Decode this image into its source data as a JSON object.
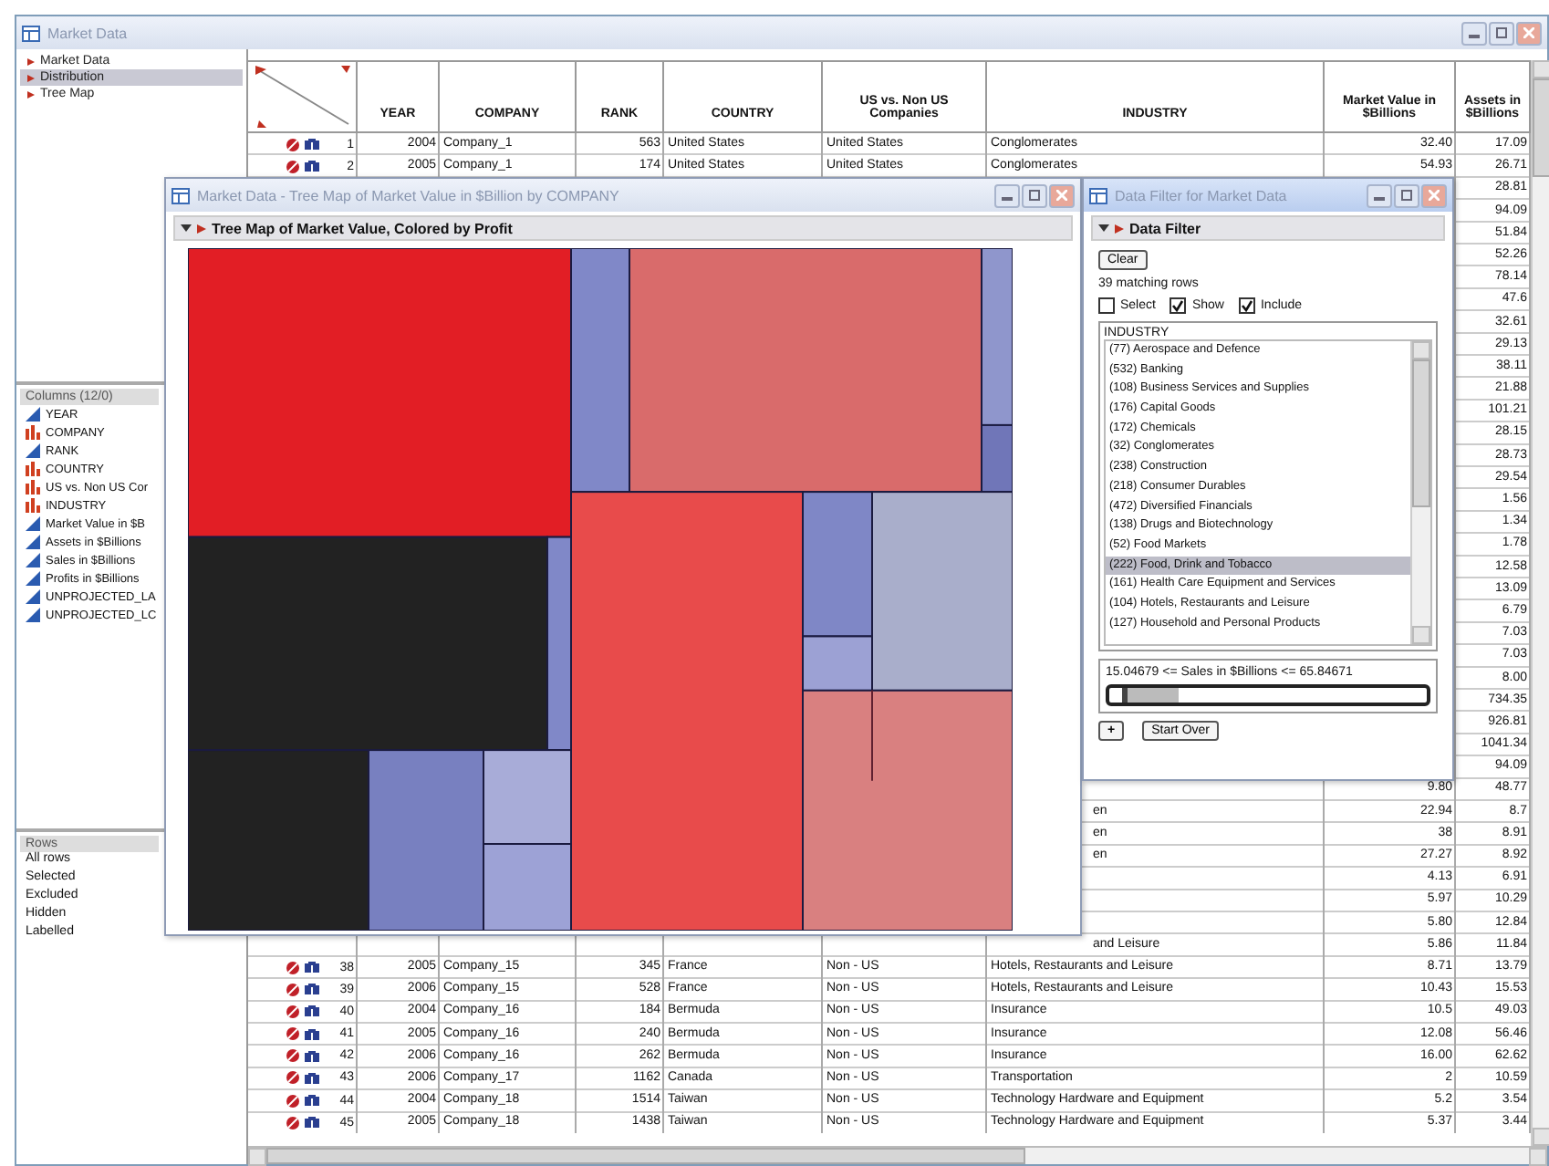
{
  "main_window": {
    "title": "Market Data",
    "tables": [
      {
        "label": "Market Data",
        "selected": false
      },
      {
        "label": "Distribution",
        "selected": true
      },
      {
        "label": "Tree Map",
        "selected": false
      }
    ],
    "columns_panel": {
      "title": "Columns (12/0)",
      "items": [
        {
          "name": "YEAR",
          "kind": "continuous"
        },
        {
          "name": "COMPANY",
          "kind": "nominal"
        },
        {
          "name": "RANK",
          "kind": "continuous"
        },
        {
          "name": "COUNTRY",
          "kind": "nominal"
        },
        {
          "name": "US vs. Non US Cor",
          "kind": "nominal"
        },
        {
          "name": "INDUSTRY",
          "kind": "nominal"
        },
        {
          "name": "Market Value in $B",
          "kind": "continuous"
        },
        {
          "name": "Assets in $Billions",
          "kind": "continuous"
        },
        {
          "name": "Sales in $Billions",
          "kind": "continuous"
        },
        {
          "name": "Profits in $Billions",
          "kind": "continuous"
        },
        {
          "name": "UNPROJECTED_LA",
          "kind": "continuous"
        },
        {
          "name": "UNPROJECTED_LC",
          "kind": "continuous"
        }
      ]
    },
    "rows_panel": {
      "title": "Rows",
      "items": [
        "All rows",
        "Selected",
        "Excluded",
        "Hidden",
        "Labelled"
      ]
    },
    "table": {
      "columns": [
        "YEAR",
        "COMPANY",
        "RANK",
        "COUNTRY",
        "US vs. Non US Companies",
        "INDUSTRY",
        "Market Value in $Billions",
        "Assets in $Billions"
      ],
      "rows": [
        {
          "number": "1",
          "cells": [
            "2004",
            "Company_1",
            "563",
            "United States",
            "United States",
            "Conglomerates",
            "32.40",
            "17.09"
          ]
        },
        {
          "number": "2",
          "cells": [
            "2005",
            "Company_1",
            "174",
            "United States",
            "United States",
            "Conglomerates",
            "54.93",
            "26.71"
          ]
        },
        {
          "cells": [
            null,
            null,
            null,
            null,
            null,
            null,
            null,
            "28.81"
          ]
        },
        {
          "cells": [
            null,
            null,
            null,
            null,
            null,
            null,
            null,
            "94.09"
          ]
        },
        {
          "cells": [
            null,
            null,
            null,
            null,
            null,
            null,
            null,
            "51.84"
          ]
        },
        {
          "cells": [
            null,
            null,
            null,
            null,
            null,
            null,
            null,
            "52.26"
          ]
        },
        {
          "cells": [
            null,
            null,
            null,
            null,
            null,
            null,
            null,
            "78.14"
          ]
        },
        {
          "cells": [
            null,
            null,
            null,
            null,
            null,
            null,
            null,
            "47.6"
          ]
        },
        {
          "cells": [
            null,
            null,
            null,
            null,
            null,
            null,
            null,
            "32.61"
          ]
        },
        {
          "cells": [
            null,
            null,
            null,
            null,
            null,
            null,
            null,
            "29.13"
          ]
        },
        {
          "cells": [
            null,
            null,
            null,
            null,
            null,
            null,
            null,
            "38.11"
          ]
        },
        {
          "cells": [
            null,
            null,
            null,
            null,
            null,
            null,
            null,
            "21.88"
          ]
        },
        {
          "cells": [
            null,
            null,
            null,
            null,
            null,
            null,
            null,
            "101.21"
          ]
        },
        {
          "cells": [
            null,
            null,
            null,
            null,
            null,
            null,
            null,
            "28.15"
          ]
        },
        {
          "cells": [
            null,
            null,
            null,
            null,
            null,
            null,
            null,
            "28.73"
          ]
        },
        {
          "cells": [
            null,
            null,
            null,
            null,
            null,
            null,
            null,
            "29.54"
          ]
        },
        {
          "cells": [
            null,
            null,
            null,
            null,
            null,
            null,
            null,
            "1.56"
          ]
        },
        {
          "cells": [
            null,
            null,
            null,
            null,
            null,
            null,
            null,
            "1.34"
          ]
        },
        {
          "cells": [
            null,
            null,
            null,
            null,
            null,
            null,
            null,
            "1.78"
          ]
        },
        {
          "cells": [
            null,
            null,
            null,
            null,
            null,
            null,
            null,
            "12.58"
          ]
        },
        {
          "cells": [
            null,
            null,
            null,
            null,
            null,
            null,
            null,
            "13.09"
          ]
        },
        {
          "cells": [
            null,
            null,
            null,
            null,
            null,
            null,
            null,
            "6.79"
          ]
        },
        {
          "cells": [
            null,
            null,
            null,
            null,
            null,
            null,
            null,
            "7.03"
          ]
        },
        {
          "cells": [
            null,
            null,
            null,
            null,
            null,
            null,
            null,
            "7.03"
          ]
        },
        {
          "cells": [
            null,
            null,
            null,
            null,
            null,
            null,
            null,
            "8.00"
          ]
        },
        {
          "cells": [
            null,
            null,
            null,
            null,
            null,
            null,
            null,
            "734.35"
          ]
        },
        {
          "cells": [
            null,
            null,
            null,
            null,
            null,
            null,
            null,
            "926.81"
          ]
        },
        {
          "cells": [
            null,
            null,
            null,
            null,
            null,
            null,
            null,
            "1041.34"
          ]
        },
        {
          "cells": [
            null,
            null,
            null,
            null,
            null,
            null,
            null,
            "94.09"
          ]
        },
        {
          "cells": [
            null,
            null,
            null,
            null,
            null,
            null,
            "9.80",
            "48.77"
          ]
        },
        {
          "cells": [
            null,
            null,
            null,
            null,
            null,
            "en",
            "22.94",
            "8.7"
          ]
        },
        {
          "cells": [
            null,
            null,
            null,
            null,
            null,
            "en",
            "38",
            "8.91"
          ]
        },
        {
          "cells": [
            null,
            null,
            null,
            null,
            null,
            "en",
            "27.27",
            "8.92"
          ]
        },
        {
          "cells": [
            null,
            null,
            null,
            null,
            null,
            null,
            "4.13",
            "6.91"
          ]
        },
        {
          "cells": [
            null,
            null,
            null,
            null,
            null,
            null,
            "5.97",
            "10.29"
          ]
        },
        {
          "cells": [
            null,
            null,
            null,
            null,
            null,
            null,
            "5.80",
            "12.84"
          ]
        },
        {
          "cells": [
            null,
            null,
            null,
            null,
            null,
            "and Leisure",
            "5.86",
            "11.84"
          ]
        },
        {
          "number": "38",
          "cells": [
            "2005",
            "Company_15",
            "345",
            "France",
            "Non - US",
            "Hotels, Restaurants and Leisure",
            "8.71",
            "13.79"
          ]
        },
        {
          "number": "39",
          "cells": [
            "2006",
            "Company_15",
            "528",
            "France",
            "Non - US",
            "Hotels, Restaurants and Leisure",
            "10.43",
            "15.53"
          ]
        },
        {
          "number": "40",
          "cells": [
            "2004",
            "Company_16",
            "184",
            "Bermuda",
            "Non - US",
            "Insurance",
            "10.5",
            "49.03"
          ]
        },
        {
          "number": "41",
          "cells": [
            "2005",
            "Company_16",
            "240",
            "Bermuda",
            "Non - US",
            "Insurance",
            "12.08",
            "56.46"
          ]
        },
        {
          "number": "42",
          "cells": [
            "2006",
            "Company_16",
            "262",
            "Bermuda",
            "Non - US",
            "Insurance",
            "16.00",
            "62.62"
          ]
        },
        {
          "number": "43",
          "cells": [
            "2006",
            "Company_17",
            "1162",
            "Canada",
            "Non - US",
            "Transportation",
            "2",
            "10.59"
          ]
        },
        {
          "number": "44",
          "cells": [
            "2004",
            "Company_18",
            "1514",
            "Taiwan",
            "Non - US",
            "Technology Hardware and Equipment",
            "5.2",
            "3.54"
          ]
        },
        {
          "number": "45",
          "cells": [
            "2005",
            "Company_18",
            "1438",
            "Taiwan",
            "Non - US",
            "Technology Hardware and Equipment",
            "5.37",
            "3.44"
          ]
        }
      ]
    }
  },
  "tree_window": {
    "title": "Market Data - Tree Map of Market Value in $Billion by COMPANY",
    "heading": "Tree Map of Market Value, Colored by Profit"
  },
  "filter_window": {
    "title": "Data Filter for Market Data",
    "heading": "Data Filter",
    "clear_button": "Clear",
    "matching": "39 matching rows",
    "options": [
      {
        "label": "Select",
        "checked": false
      },
      {
        "label": "Show",
        "checked": true
      },
      {
        "label": "Include",
        "checked": true
      }
    ],
    "list_title": "INDUSTRY",
    "industries": [
      {
        "label": "(77) Aerospace and Defence",
        "selected": false
      },
      {
        "label": "(532) Banking",
        "selected": false
      },
      {
        "label": "(108) Business Services and Supplies",
        "selected": false
      },
      {
        "label": "(176) Capital Goods",
        "selected": false
      },
      {
        "label": "(172) Chemicals",
        "selected": false
      },
      {
        "label": "(32) Conglomerates",
        "selected": false
      },
      {
        "label": "(238) Construction",
        "selected": false
      },
      {
        "label": "(218) Consumer Durables",
        "selected": false
      },
      {
        "label": "(472) Diversified Financials",
        "selected": false
      },
      {
        "label": "(138) Drugs and Biotechnology",
        "selected": false
      },
      {
        "label": "(52) Food Markets",
        "selected": false
      },
      {
        "label": "(222) Food, Drink and Tobacco",
        "selected": true
      },
      {
        "label": "(161) Health Care Equipment and Services",
        "selected": false
      },
      {
        "label": "(104) Hotels, Restaurants and Leisure",
        "selected": false
      },
      {
        "label": "(127) Household and Personal Products",
        "selected": false
      }
    ],
    "range_text": "15.04679 <= Sales in $Billions <= 65.84671",
    "range": {
      "level": 0.18
    },
    "add_button": "+",
    "start_over_button": "Start Over"
  }
}
